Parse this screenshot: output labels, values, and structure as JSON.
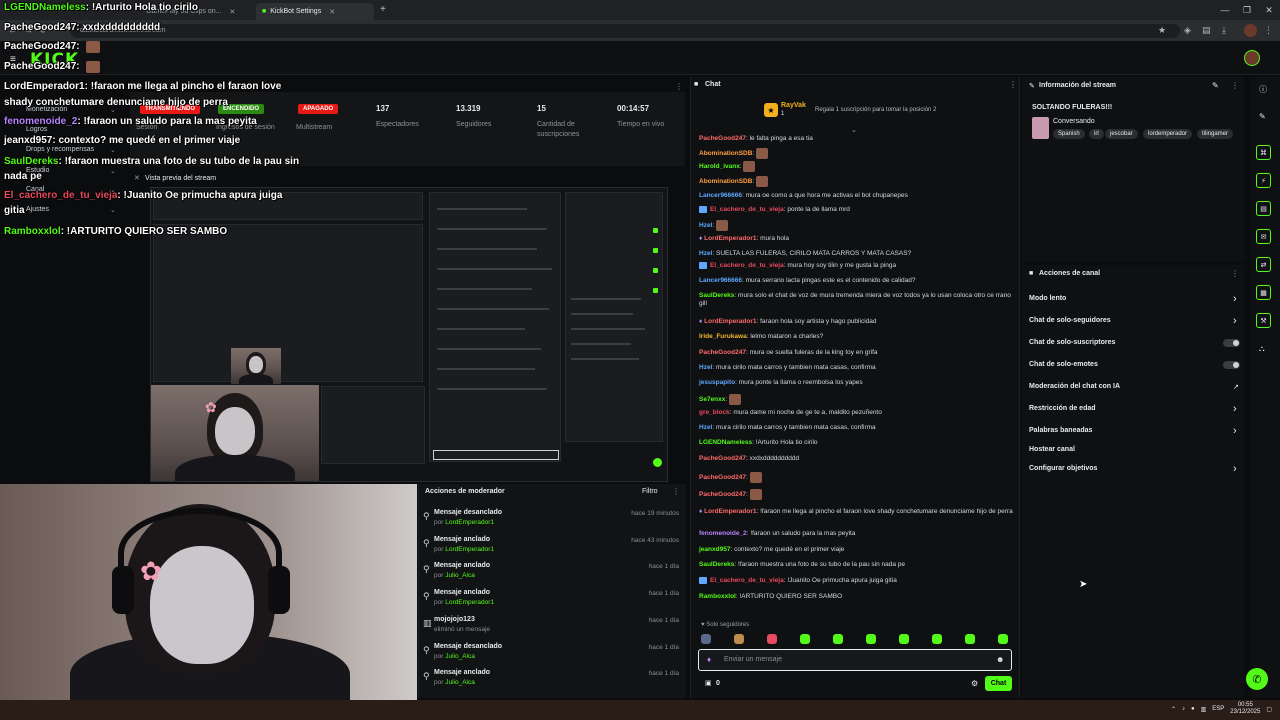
{
  "browser": {
    "tabs": [
      {
        "label": "GamePlay 3d Clips on..."
      },
      {
        "label": "KickBot Settings"
      }
    ],
    "new_tab": "+",
    "window_controls": [
      "—",
      "❐",
      "✕"
    ],
    "url": "dashboard.kick.com/stream"
  },
  "header": {
    "logo": "KICK"
  },
  "sidebar": {
    "items": [
      {
        "label": "Logros"
      },
      {
        "label": "Monetización"
      },
      {
        "label": "Drops y recompensas"
      },
      {
        "label": "Estudio"
      },
      {
        "label": "Canal"
      },
      {
        "label": "Ajustes"
      }
    ]
  },
  "stats": {
    "pill_live": "TRANSMITIENDO",
    "pill_session": "ENCENDIDO",
    "pill_multi": "APAGADO",
    "session_label": "Sesión",
    "income_label": "Ingresos de sesión",
    "multistream_label": "Multistream",
    "viewers_value": "137",
    "viewers_label": "Espectadores",
    "followers_value": "13.319",
    "followers_label": "Seguidores",
    "subs_value": "15",
    "subs_label": "Cantidad de suscripciones",
    "time_value": "00:14:57",
    "time_label": "Tiempo en vivo"
  },
  "preview": {
    "title": "Vista previa del stream"
  },
  "mod_actions": {
    "title": "Acciones de moderador",
    "filter": "Filtro",
    "rows": [
      {
        "icon": "unpin-icon",
        "action": "Mensaje desanclado",
        "by_prefix": "por",
        "by": "LordEmperador1",
        "time": "hace 19 minutos"
      },
      {
        "icon": "pin-icon",
        "action": "Mensaje anclado",
        "by_prefix": "por",
        "by": "LordEmperador1",
        "time": "hace 43 minutos"
      },
      {
        "icon": "pin-icon",
        "action": "Mensaje anclado",
        "by_prefix": "por",
        "by": "Julio_Alca",
        "time": "hace 1 día"
      },
      {
        "icon": "pin-icon",
        "action": "Mensaje anclado",
        "by_prefix": "por",
        "by": "LordEmperador1",
        "time": "hace 1 día"
      },
      {
        "icon": "trash-icon",
        "action": "mojojojo123",
        "by_prefix": "",
        "by": "eliminó un mensaje",
        "time": "hace 1 día"
      },
      {
        "icon": "unpin-icon",
        "action": "Mensaje desanclado",
        "by_prefix": "por",
        "by": "Julio_Alca",
        "time": "hace 1 día"
      },
      {
        "icon": "pin-icon",
        "action": "Mensaje anclado",
        "by_prefix": "por",
        "by": "Julio_Alca",
        "time": "hace 1 día"
      }
    ]
  },
  "chat": {
    "title": "Chat",
    "gift_user": "RayVak",
    "gift_count": "1",
    "gift_text": "Regala 1 suscripción para tomar la posición 2",
    "messages": [
      {
        "user": "PacheGood247",
        "color": "#ff6b6b",
        "text": "le falta pinga a esa tia",
        "emote": false
      },
      {
        "user": "AbominationSDB",
        "color": "#ff9f43",
        "text": "",
        "emote": true
      },
      {
        "user": "Harold_ivanx",
        "color": "#53fc18",
        "text": "",
        "emote": true
      },
      {
        "user": "AbominationSDB",
        "color": "#ff9f43",
        "text": "",
        "emote": true
      },
      {
        "user": "Lancer966666",
        "color": "#5fa8ff",
        "text": "mura oe como a que hora me activas el bot chupanepes",
        "emote": false
      },
      {
        "user": "El_cachero_de_tu_vieja",
        "color": "#e84a5f",
        "text": "ponte la de llama mrd",
        "emote": false
      },
      {
        "user": "Hzel",
        "color": "#5fa8ff",
        "text": "",
        "emote": true
      },
      {
        "user": "LordEmperador1",
        "color": "#ff6b6b",
        "text": "mura hola",
        "emote": false
      },
      {
        "user": "Hzel",
        "color": "#5fa8ff",
        "text": "SUELTA LAS FULERAS, CIRILO MATA CARROS Y MATA CASAS?",
        "emote": false
      },
      {
        "user": "El_cachero_de_tu_vieja",
        "color": "#e84a5f",
        "text": "mura hoy soy tilin y me gusta la pinga",
        "emote": false
      },
      {
        "user": "Lancer966666",
        "color": "#5fa8ff",
        "text": "mura serrano lacta pingas este es el contenido de calidad?",
        "emote": false
      },
      {
        "user": "SaulDereks",
        "color": "#53fc18",
        "text": "mura solo el chat de voz de mura tremenda miera de voz todos ya lo usan coloca otro ce rrano gill",
        "emote": false
      },
      {
        "user": "LordEmperador1",
        "color": "#ff6b6b",
        "text": "faraon hola soy artista y hago publicidad",
        "emote": false
      },
      {
        "user": "Iride_Furukawa",
        "color": "#f7b731",
        "text": "lelmo mataron a charles?",
        "emote": false
      },
      {
        "user": "PacheGood247",
        "color": "#ff6b6b",
        "text": "mura oe suelta fuleras de la king toy en grifa",
        "emote": false
      },
      {
        "user": "Hzel",
        "color": "#5fa8ff",
        "text": "mura cirilo mata carros y tambien mata casas, confirma",
        "emote": false
      },
      {
        "user": "jesuspapito",
        "color": "#5fa8ff",
        "text": "mura ponte la llama o reembolsa los yapes",
        "emote": false
      },
      {
        "user": "Se7enxx",
        "color": "#53fc18",
        "text": "",
        "emote": true
      },
      {
        "user": "gre_block",
        "color": "#e84a5f",
        "text": "mura dame mi noche de ge te a, maldito pezuñento",
        "emote": false
      },
      {
        "user": "Hzel",
        "color": "#5fa8ff",
        "text": "mura cirilo mata carros y tambien mata casas, confirma",
        "emote": false
      },
      {
        "user": "LGENDNameless",
        "color": "#53fc18",
        "text": "!Arturito Hola tio cirilo",
        "emote": false
      },
      {
        "user": "PacheGood247",
        "color": "#ff6b6b",
        "text": "xxdxdddddddddd",
        "emote": false
      },
      {
        "user": "PacheGood247",
        "color": "#ff6b6b",
        "text": "",
        "emote": true
      },
      {
        "user": "PacheGood247",
        "color": "#ff6b6b",
        "text": "",
        "emote": true
      },
      {
        "user": "LordEmperador1",
        "color": "#ff6b6b",
        "text": "!faraon me llega al pincho el faraon love shady conchetumare denunciame hijo de perra",
        "emote": false
      },
      {
        "user": "fenomenoide_2",
        "color": "#b983ff",
        "text": "!faraon un saludo para la mas peyita",
        "emote": false
      },
      {
        "user": "jeanxd957",
        "color": "#53fc18",
        "text": "contexto? me quedé en el primer viaje",
        "emote": false
      },
      {
        "user": "SaulDereks",
        "color": "#53fc18",
        "text": "!faraon muestra una foto de su tubo de la pau sin nada pe",
        "emote": false
      },
      {
        "user": "El_cachero_de_tu_vieja",
        "color": "#e84a5f",
        "text": "!Juanito Oe primucha apura juiga gitia",
        "emote": false
      },
      {
        "user": "Ramboxxlol",
        "color": "#53fc18",
        "text": "!ARTURITO QUIERO SER SAMBO",
        "emote": false
      }
    ],
    "followers_only": "Solo seguidores",
    "input_placeholder": "Enviar un mensaje",
    "points": "0",
    "send": "Chat"
  },
  "stream_info": {
    "title": "Información del stream",
    "stream_title": "SOLTANDO FULERAS!!!",
    "category": "Conversando",
    "tags": [
      "Spanish",
      "irl",
      "jescobar",
      "lordemperador",
      "tilingamer"
    ]
  },
  "channel_actions": {
    "title": "Acciones de canal",
    "items": [
      {
        "label": "Modo lento",
        "control": "arrow"
      },
      {
        "label": "Chat de solo-seguidores",
        "control": "arrow"
      },
      {
        "label": "Chat de solo-suscriptores",
        "control": "toggle"
      },
      {
        "label": "Chat de solo-emotes",
        "control": "toggle"
      },
      {
        "label": "Moderación del chat con IA",
        "control": "external"
      },
      {
        "label": "Restricción de edad",
        "control": "arrow"
      },
      {
        "label": "Palabras baneadas",
        "control": "arrow"
      },
      {
        "label": "Hostear canal",
        "control": "none"
      },
      {
        "label": "Configurar objetivos",
        "control": "arrow"
      }
    ]
  },
  "overlay_chat": [
    {
      "user": "LGENDNameless",
      "color": "#53fc18",
      "text": "!Arturito Hola tio cirilo"
    },
    {
      "user": "PacheGood247",
      "color": "#ffffff",
      "text": "xxdxddddddddd"
    },
    {
      "user": "PacheGood247",
      "color": "#ffffff",
      "text": ""
    },
    {
      "user": "PacheGood247",
      "color": "#ffffff",
      "text": ""
    },
    {
      "user": "LordEmperador1",
      "color": "#ffffff",
      "text": "!faraon me llega al pincho el faraon love"
    },
    {
      "user": "",
      "color": "#ffffff",
      "text": "shady conchetumare denunciame hijo de perra"
    },
    {
      "user": "fenomenoide_2",
      "color": "#b983ff",
      "text": "!faraon un saludo para la mas peyita"
    },
    {
      "user": "jeanxd957",
      "color": "#ffffff",
      "text": "contexto? me quedé en el primer viaje"
    },
    {
      "user": "SaulDereks",
      "color": "#53fc18",
      "text": "!faraon muestra una foto de su tubo de la pau sin"
    },
    {
      "user": "",
      "color": "#ffffff",
      "text": "nada pe"
    },
    {
      "user": "El_cachero_de_tu_vieja",
      "color": "#e84a5f",
      "text": "!Juanito Oe primucha apura juiga"
    },
    {
      "user": "",
      "color": "#ffffff",
      "text": "gitia"
    },
    {
      "user": "Ramboxxlol",
      "color": "#53fc18",
      "text": "!ARTURITO QUIERO SER SAMBO"
    }
  ],
  "taskbar": {
    "lang": "ESP",
    "time": "00:55",
    "date": "23/12/2025"
  },
  "colors": {
    "accent": "#53fc18",
    "bg": "#0f1012",
    "live_red": "#e91916"
  }
}
